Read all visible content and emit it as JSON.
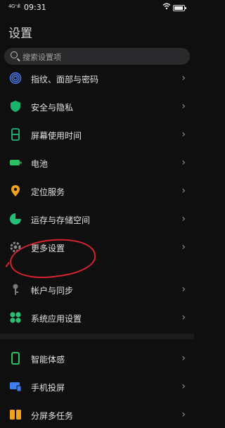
{
  "status": {
    "signal": "4G⁺ıll",
    "time": "09:31",
    "wifi": "wifi-icon",
    "battery_level": 0.82
  },
  "title": "设置",
  "search": {
    "placeholder": "搜索设置项"
  },
  "rows": [
    {
      "label": "指纹、面部与密码",
      "icon": "fingerprint-icon",
      "color": "#4f7cf5"
    },
    {
      "label": "安全与隐私",
      "icon": "shield-icon",
      "color": "#18b46d"
    },
    {
      "label": "屏幕使用时间",
      "icon": "hourglass-icon",
      "color": "#22b97c"
    },
    {
      "label": "电池",
      "icon": "battery-icon",
      "color": "#2ac164"
    },
    {
      "label": "定位服务",
      "icon": "location-pin-icon",
      "color": "#f2a11b"
    },
    {
      "label": "运存与存储空间",
      "icon": "pie-chart-icon",
      "color": "#20c076"
    },
    {
      "label": "更多设置",
      "icon": "gear-icon",
      "color": "#8a8a8a"
    },
    {
      "label": "帐户与同步",
      "icon": "key-icon",
      "color": "#7a7a7a"
    },
    {
      "label": "系统应用设置",
      "icon": "apps-grid-icon",
      "color": "#2fbf73"
    },
    {
      "label": "智能体感",
      "icon": "phone-outline-icon",
      "color": "#2ac164"
    },
    {
      "label": "手机投屏",
      "icon": "screen-cast-icon",
      "color": "#3c7df2"
    },
    {
      "label": "分屏多任务",
      "icon": "split-screen-icon",
      "color": "#f2a11b"
    }
  ],
  "chevron": "›"
}
